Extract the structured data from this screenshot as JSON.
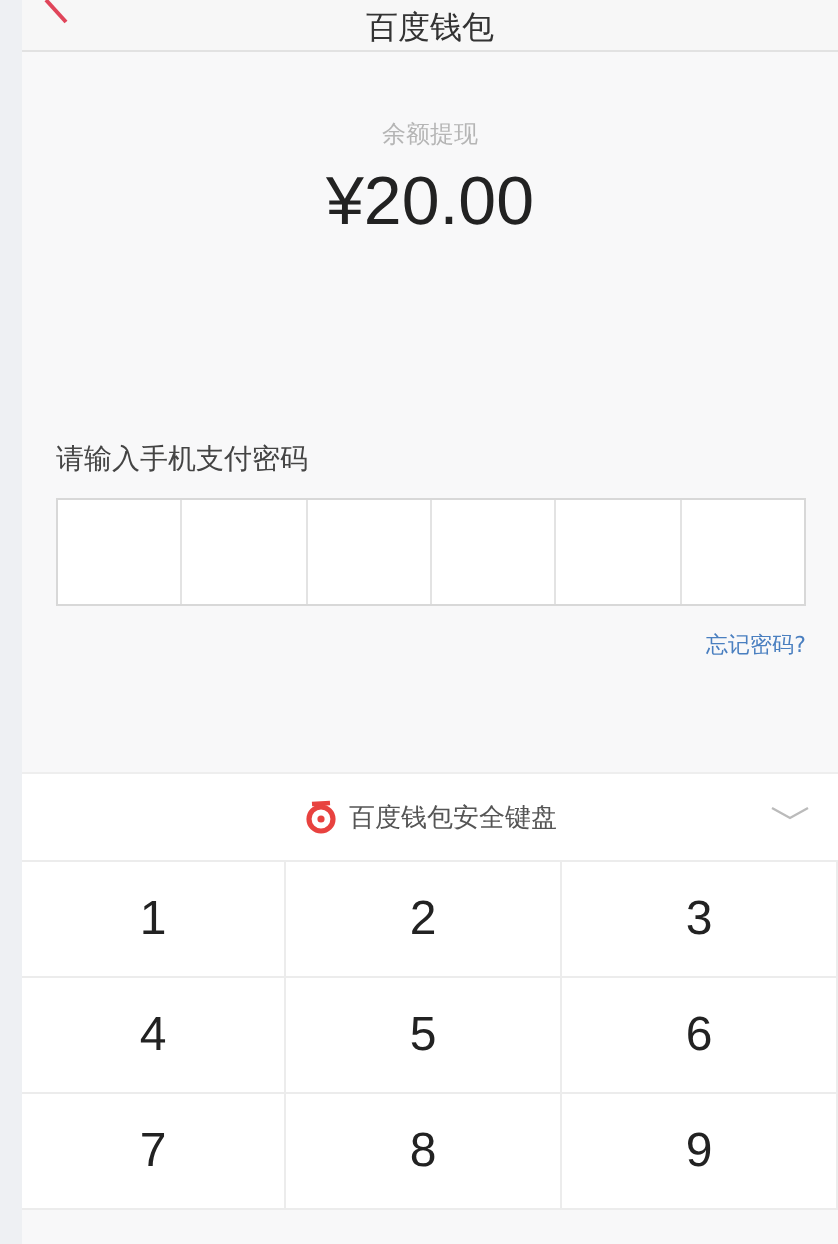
{
  "header": {
    "title": "百度钱包"
  },
  "withdraw": {
    "label": "余额提现",
    "amount": "¥20.00"
  },
  "password": {
    "label": "请输入手机支付密码",
    "cells": [
      {
        "filled": false
      },
      {
        "filled": false
      },
      {
        "filled": false
      },
      {
        "filled": false
      },
      {
        "filled": false
      },
      {
        "filled": false
      }
    ],
    "forgot": "忘记密码?"
  },
  "keyboard": {
    "title": "百度钱包安全键盘",
    "keys": [
      "1",
      "2",
      "3",
      "4",
      "5",
      "6",
      "7",
      "8",
      "9"
    ]
  }
}
